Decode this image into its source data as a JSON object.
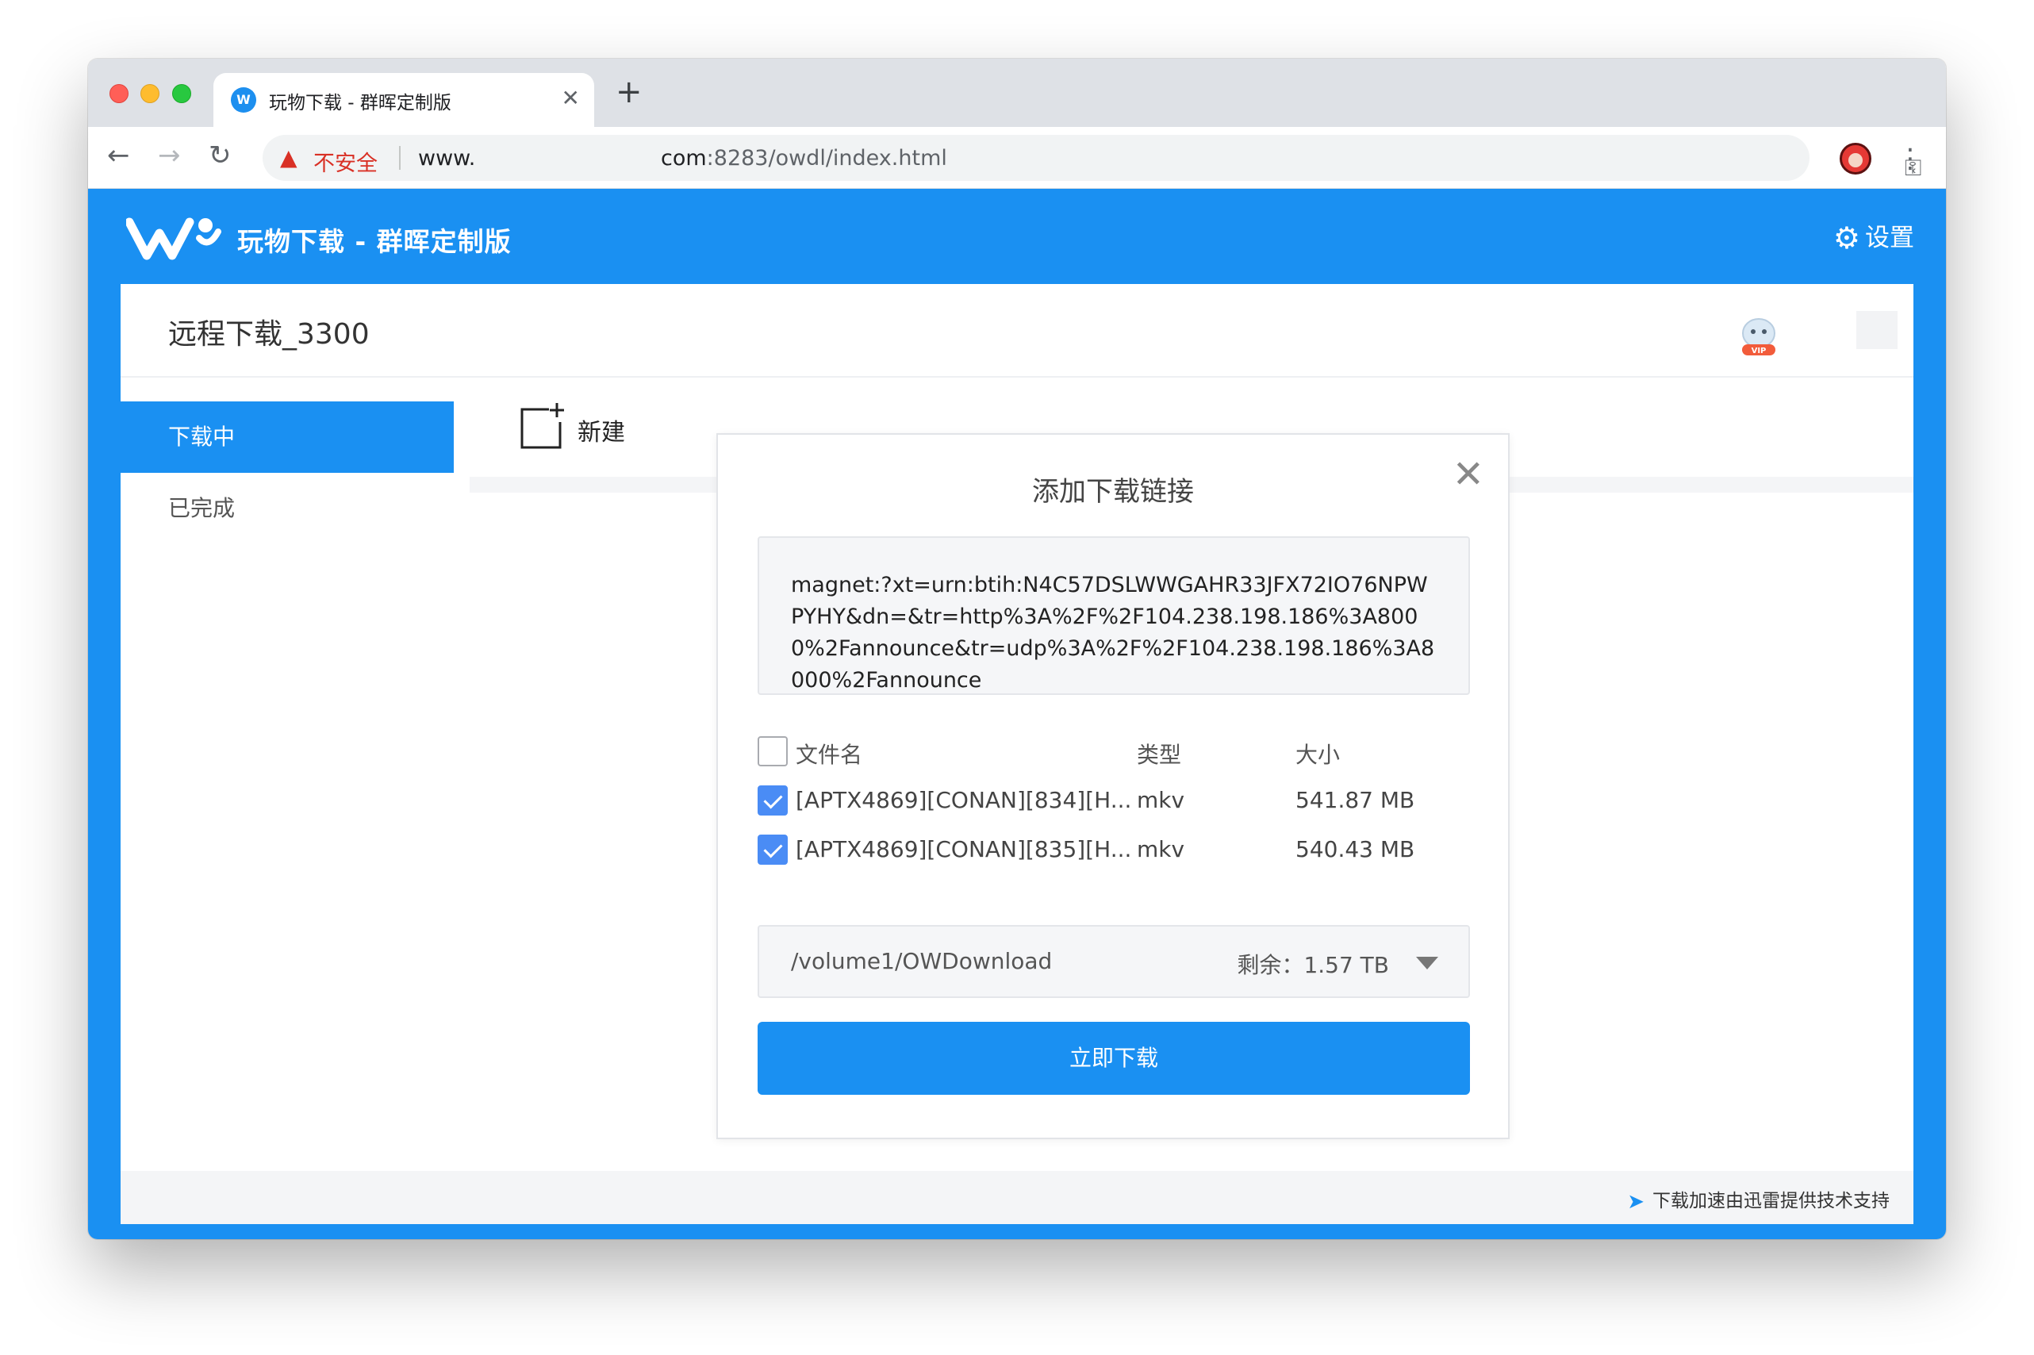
{
  "browser": {
    "tab_title": "玩物下载 - 群晖定制版",
    "tab_close": "✕",
    "new_tab": "+",
    "security_label": "不安全",
    "url_part1": "www.",
    "url_part2_host": "com",
    "url_part2_path": ":8283/owdl/index.html"
  },
  "header": {
    "app_title": "玩物下载 - 群晖定制版",
    "settings_label": "设置"
  },
  "panel": {
    "title": "远程下载_3300",
    "vip_label": "VIP"
  },
  "sidebar": {
    "items": [
      {
        "label": "下载中",
        "active": true
      },
      {
        "label": "已完成",
        "active": false
      }
    ]
  },
  "toolbar": {
    "new_label": "新建"
  },
  "dialog": {
    "title": "添加下载链接",
    "link_text": "magnet:?xt=urn:btih:N4C57DSLWWGAHR33JFX72IO76NPWPYHY&dn=&tr=http%3A%2F%2F104.238.198.186%3A8000%2Fannounce&tr=udp%3A%2F%2F104.238.198.186%3A8000%2Fannounce",
    "columns": {
      "name": "文件名",
      "type": "类型",
      "size": "大小"
    },
    "files": [
      {
        "name": "[APTX4869][CONAN][834][H...",
        "type": "mkv",
        "size": "541.87 MB",
        "checked": true
      },
      {
        "name": "[APTX4869][CONAN][835][H...",
        "type": "mkv",
        "size": "540.43 MB",
        "checked": true
      }
    ],
    "path": "/volume1/OWDownload",
    "remaining": "剩余：1.57 TB",
    "download_button": "立即下载"
  },
  "footer": {
    "text": "下载加速由迅雷提供技术支持"
  },
  "colors": {
    "brand_blue": "#1a90f2",
    "checkbox_blue": "#4a8cf5",
    "warning_red": "#d93025",
    "star_blue": "#1a73e8"
  }
}
